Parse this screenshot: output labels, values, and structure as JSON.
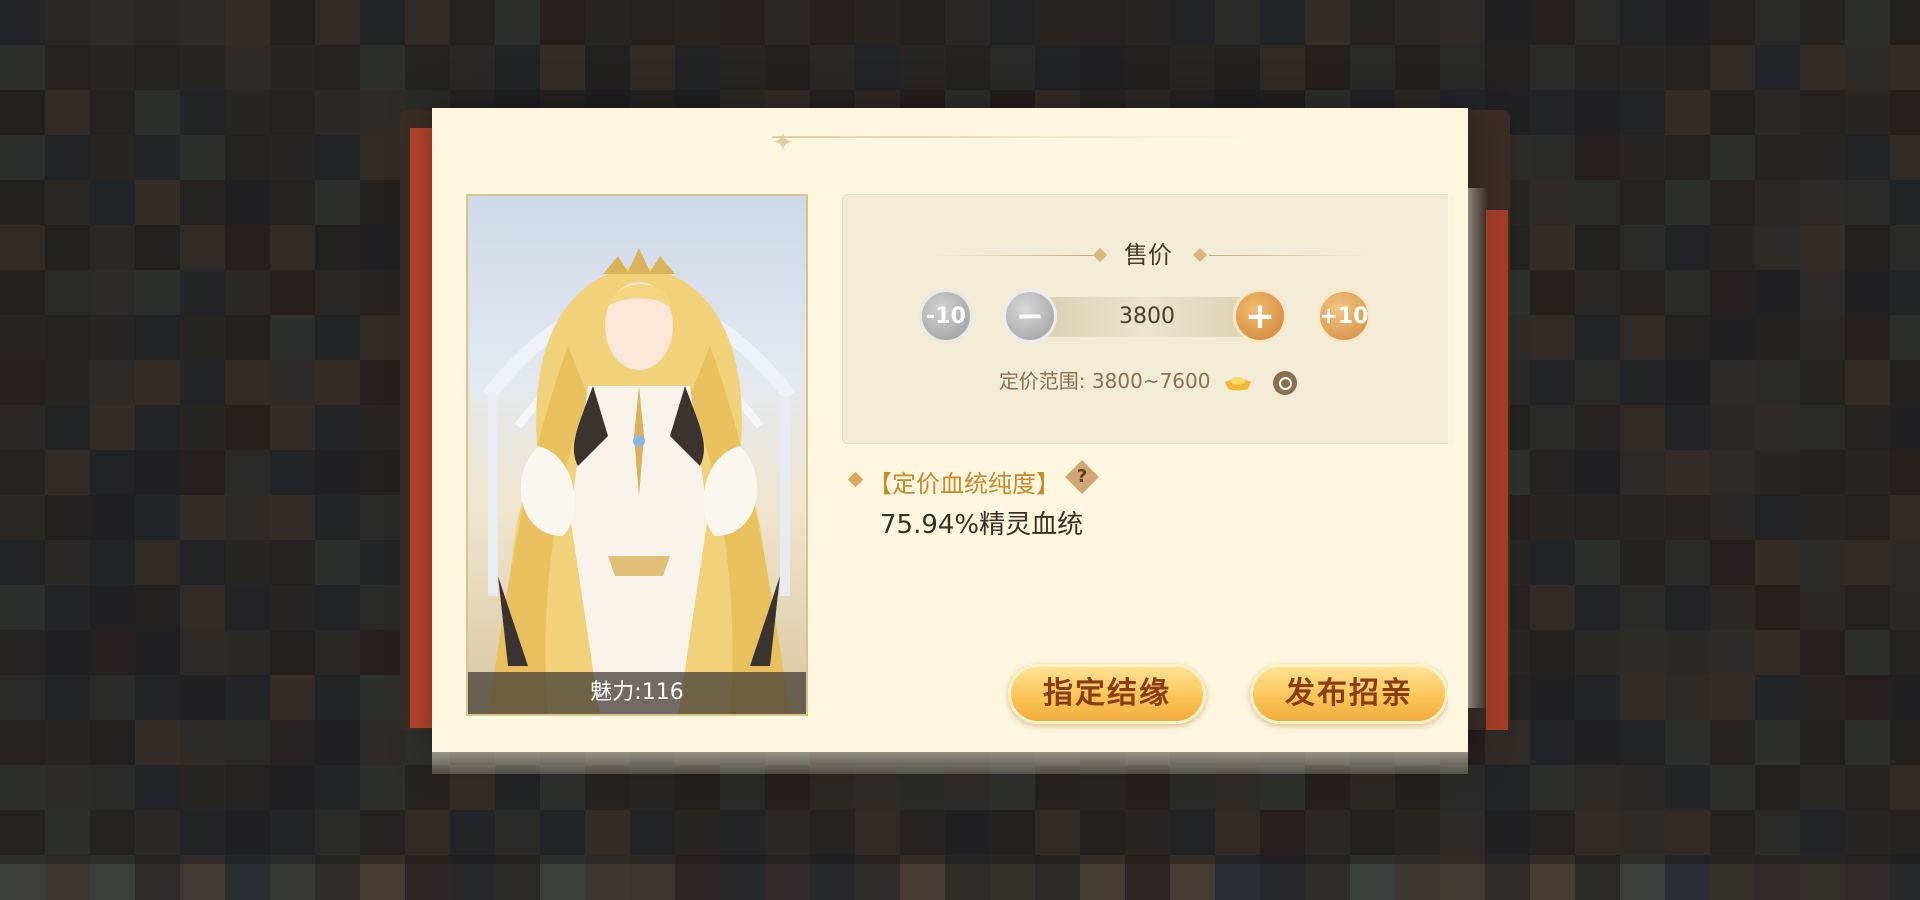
{
  "dialog": {
    "title": "",
    "character": {
      "charm_label": "魅力:116"
    },
    "price_panel": {
      "title": "售价",
      "minus10_label": "-10",
      "minus_label": "−",
      "plus_label": "+",
      "plus10_label": "+10",
      "current_price": "3800",
      "range_text": "定价范围: 3800~7600",
      "currency_icon": "gold-ingot-icon",
      "info_icon": "magnifier-icon"
    },
    "pedigree": {
      "title": "【定价血统纯度】",
      "help": "?",
      "value": "75.94%精灵血统"
    },
    "buttons": {
      "assign_label": "指定结缘",
      "publish_label": "发布招亲"
    }
  },
  "colors": {
    "dialog_bg": "#fdf7e0",
    "accent_gold": "#c88b2b",
    "button_text": "#8a3d12"
  }
}
